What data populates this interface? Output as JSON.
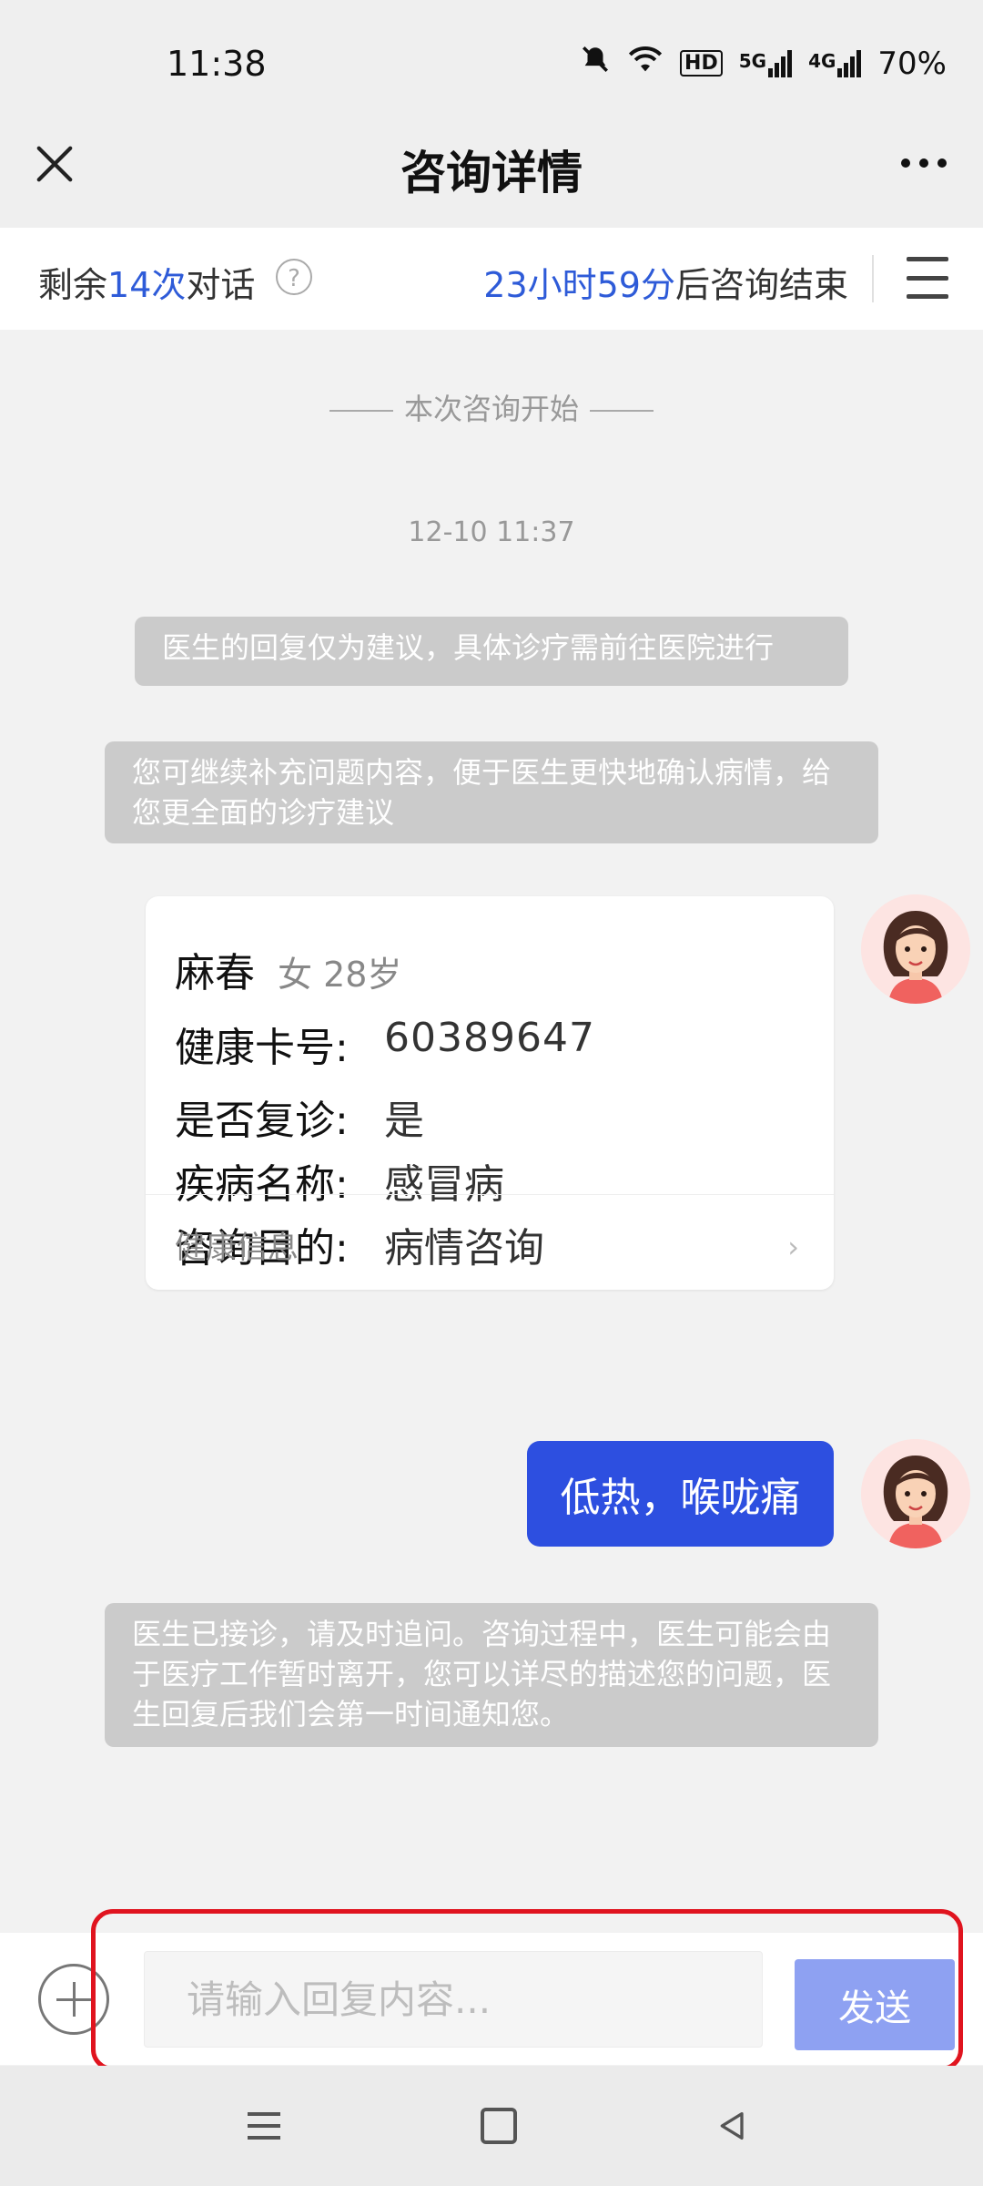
{
  "status_bar": {
    "time": "11:38",
    "battery": "70%",
    "network_5g": "5G",
    "network_4g": "4G",
    "hd_badge": "HD"
  },
  "header": {
    "title": "咨询详情"
  },
  "info_bar": {
    "remain_prefix": "剩余",
    "remain_count": "14次",
    "remain_suffix": "对话",
    "help": "?",
    "timer_value": "23小时59分",
    "timer_suffix": "后咨询结束"
  },
  "chat": {
    "start_line": "本次咨询开始",
    "timestamp": "12-10 11:37",
    "notice1": "医生的回复仅为建议，具体诊疗需前往医院进行",
    "notice2": "您可继续补充问题内容，便于医生更快地确认病情，给您更全面的诊疗建议",
    "card": {
      "name": "麻春",
      "meta": "女 28岁",
      "rows": [
        {
          "label": "健康卡号:",
          "value": "60389647"
        },
        {
          "label": "是否复诊:",
          "value": "是"
        },
        {
          "label": "疾病名称:",
          "value": "感冒病"
        },
        {
          "label": "咨询目的:",
          "value": "病情咨询"
        }
      ],
      "footer": "健康信息",
      "chevron": "›"
    },
    "user_message": "低热，喉咙痛",
    "notice3": "医生已接诊，请及时追问。咨询过程中，医生可能会由于医疗工作暂时离开，您可以详尽的描述您的问题，医生回复后我们会第一时间通知您。"
  },
  "input": {
    "placeholder": "请输入回复内容...",
    "value": "",
    "send_label": "发送"
  },
  "icons": {
    "close": "close-icon",
    "more": "more-icon",
    "menu": "menu-icon",
    "help": "help-icon",
    "add": "plus-icon",
    "avatar": "avatar-icon",
    "nav_menu": "nav-menu-icon",
    "nav_home": "nav-home-icon",
    "nav_back": "nav-back-icon"
  },
  "colors": {
    "accent": "#2e5bd8",
    "bubble": "#2d4fe0",
    "send_button": "#8ea1f2",
    "notice_bg": "#cbcbcb",
    "highlight": "#e0141f"
  }
}
